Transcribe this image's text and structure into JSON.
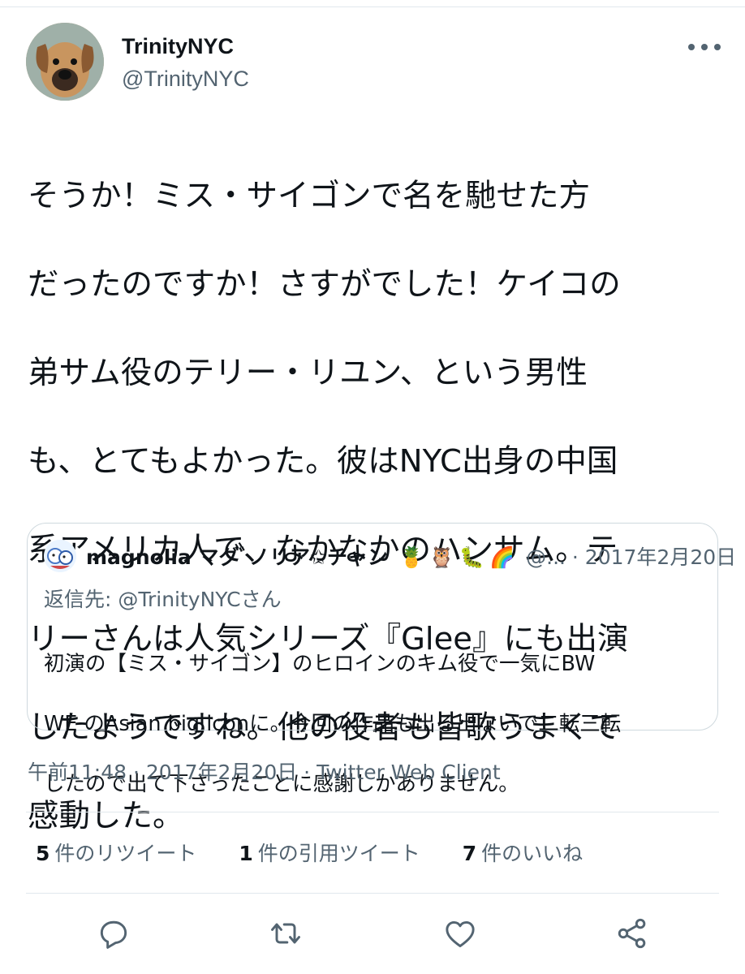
{
  "author": {
    "display_name": "TrinityNYC",
    "handle": "@TrinityNYC",
    "avatar_icon": "dog-avatar"
  },
  "tweet": {
    "text_lines": [
      "そうか！ミス・サイゴンで名を馳せた方",
      "だったのですか！さすがでした！ケイコの",
      "弟サム役のテリー・リユン、という男性",
      "も、とてもよかった。彼はNYC出身の中国",
      "系アメリカ人で、なかなかのハンサム。テ",
      "リーさんは人気シリーズ『Glee』にも出演",
      "したようですね。他の役者も皆歌うまくて",
      "感動した。"
    ],
    "timestamp": "午前11:48 · 2017年2月20日 · Twitter Web Client"
  },
  "quoted_tweet": {
    "display_name": "magnolia マグﾞノリア✩チャン",
    "emoji": "🍍🦉🐛🌈",
    "handle_date": "@... · 2017年2月20日",
    "replying_to": "返信先: @TrinityNYCさん",
    "text_lines": [
      "初演の【ミス・サイゴン】のヒロインのキム役で一気にBW",
      "WE のAsian big iconに。今回の作品も出る出ないで二転三転",
      "したので出て下さったことに感謝しかありません。"
    ]
  },
  "stats": {
    "retweets": {
      "count": "5",
      "label": "件のリツイート"
    },
    "quotes": {
      "count": "1",
      "label": "件の引用ツイート"
    },
    "likes": {
      "count": "7",
      "label": "件のいいね"
    }
  },
  "actions": {
    "reply_icon": "reply-icon",
    "retweet_icon": "retweet-icon",
    "like_icon": "heart-icon",
    "share_icon": "share-icon"
  },
  "colors": {
    "primary_text": "#0f1419",
    "secondary_text": "#536471",
    "border": "#cfd9de"
  }
}
